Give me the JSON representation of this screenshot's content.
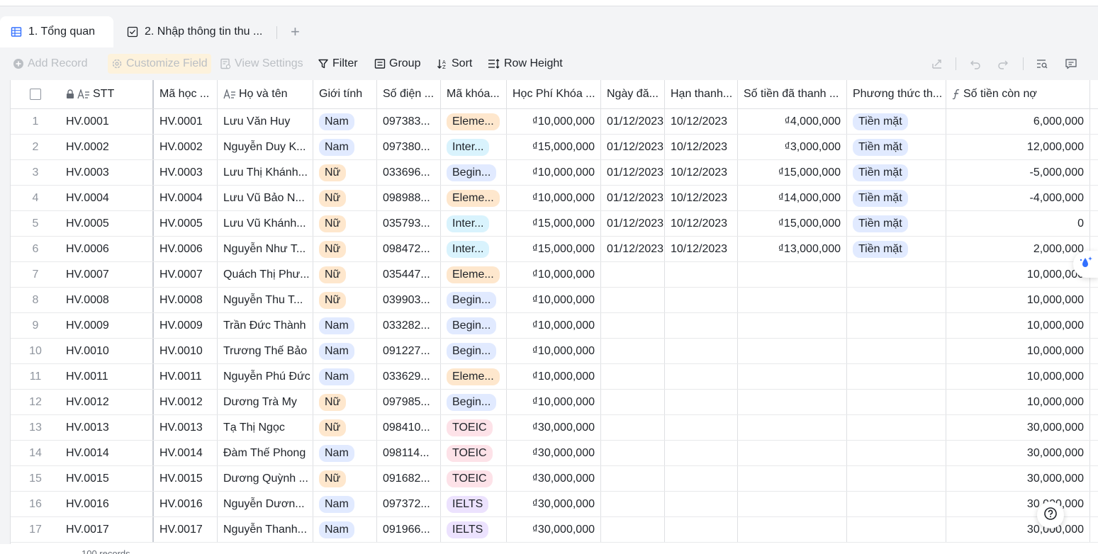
{
  "tabs": [
    {
      "label": "1. Tổng quan",
      "active": true
    },
    {
      "label": "2. Nhập thông tin thu ...",
      "active": false
    }
  ],
  "toolbar": {
    "add_record": "Add Record",
    "customize_field": "Customize Field",
    "view_settings": "View Settings",
    "filter": "Filter",
    "group": "Group",
    "sort": "Sort",
    "row_height": "Row Height"
  },
  "columns": [
    "STT",
    "Mã học ...",
    "Họ và tên",
    "Giới tính",
    "Số điện ...",
    "Mã khóa...",
    "Học Phí Khóa ...",
    "Ngày đă...",
    "Hạn thanh...",
    "Số tiền đã thanh ...",
    "Phương thức th...",
    "Số tiền còn nợ"
  ],
  "rows": [
    {
      "idx": "1",
      "stt": "HV.0001",
      "ma": "HV.0001",
      "name": "Lưu Văn Huy",
      "gender": "Nam",
      "phone": "097383...",
      "course": "Eleme...",
      "course_type": "elem",
      "fee": "₫10,000,000",
      "date": "01/12/2023",
      "due": "10/12/2023",
      "paid": "₫4,000,000",
      "method": "Tiền mặt",
      "debt": "6,000,000"
    },
    {
      "idx": "2",
      "stt": "HV.0002",
      "ma": "HV.0002",
      "name": "Nguyễn Duy K...",
      "gender": "Nam",
      "phone": "097380...",
      "course": "Inter...",
      "course_type": "inter",
      "fee": "₫15,000,000",
      "date": "01/12/2023",
      "due": "10/12/2023",
      "paid": "₫3,000,000",
      "method": "Tiền mặt",
      "debt": "12,000,000"
    },
    {
      "idx": "3",
      "stt": "HV.0003",
      "ma": "HV.0003",
      "name": "Lưu Thị Khánh...",
      "gender": "Nữ",
      "phone": "033696...",
      "course": "Begin...",
      "course_type": "begin",
      "fee": "₫10,000,000",
      "date": "01/12/2023",
      "due": "10/12/2023",
      "paid": "₫15,000,000",
      "method": "Tiền mặt",
      "debt": "-5,000,000"
    },
    {
      "idx": "4",
      "stt": "HV.0004",
      "ma": "HV.0004",
      "name": "Lưu Vũ Bảo N...",
      "gender": "Nữ",
      "phone": "098988...",
      "course": "Eleme...",
      "course_type": "elem",
      "fee": "₫10,000,000",
      "date": "01/12/2023",
      "due": "10/12/2023",
      "paid": "₫14,000,000",
      "method": "Tiền mặt",
      "debt": "-4,000,000"
    },
    {
      "idx": "5",
      "stt": "HV.0005",
      "ma": "HV.0005",
      "name": "Lưu Vũ Khánh...",
      "gender": "Nữ",
      "phone": "035793...",
      "course": "Inter...",
      "course_type": "inter",
      "fee": "₫15,000,000",
      "date": "01/12/2023",
      "due": "10/12/2023",
      "paid": "₫15,000,000",
      "method": "Tiền mặt",
      "debt": "0"
    },
    {
      "idx": "6",
      "stt": "HV.0006",
      "ma": "HV.0006",
      "name": "Nguyễn Như T...",
      "gender": "Nữ",
      "phone": "098472...",
      "course": "Inter...",
      "course_type": "inter",
      "fee": "₫15,000,000",
      "date": "01/12/2023",
      "due": "10/12/2023",
      "paid": "₫13,000,000",
      "method": "Tiền mặt",
      "debt": "2,000,000"
    },
    {
      "idx": "7",
      "stt": "HV.0007",
      "ma": "HV.0007",
      "name": "Quách Thị Phư...",
      "gender": "Nữ",
      "phone": "035447...",
      "course": "Eleme...",
      "course_type": "elem",
      "fee": "₫10,000,000",
      "date": "",
      "due": "",
      "paid": "",
      "method": "",
      "debt": "10,000,000"
    },
    {
      "idx": "8",
      "stt": "HV.0008",
      "ma": "HV.0008",
      "name": "Nguyễn Thu T...",
      "gender": "Nữ",
      "phone": "039903...",
      "course": "Begin...",
      "course_type": "begin",
      "fee": "₫10,000,000",
      "date": "",
      "due": "",
      "paid": "",
      "method": "",
      "debt": "10,000,000"
    },
    {
      "idx": "9",
      "stt": "HV.0009",
      "ma": "HV.0009",
      "name": "Trần Đức Thành",
      "gender": "Nam",
      "phone": "033282...",
      "course": "Begin...",
      "course_type": "begin",
      "fee": "₫10,000,000",
      "date": "",
      "due": "",
      "paid": "",
      "method": "",
      "debt": "10,000,000"
    },
    {
      "idx": "10",
      "stt": "HV.0010",
      "ma": "HV.0010",
      "name": "Trương Thế Bảo",
      "gender": "Nam",
      "phone": "091227...",
      "course": "Begin...",
      "course_type": "begin",
      "fee": "₫10,000,000",
      "date": "",
      "due": "",
      "paid": "",
      "method": "",
      "debt": "10,000,000"
    },
    {
      "idx": "11",
      "stt": "HV.0011",
      "ma": "HV.0011",
      "name": "Nguyễn Phú Đức",
      "gender": "Nam",
      "phone": "033629...",
      "course": "Eleme...",
      "course_type": "elem",
      "fee": "₫10,000,000",
      "date": "",
      "due": "",
      "paid": "",
      "method": "",
      "debt": "10,000,000"
    },
    {
      "idx": "12",
      "stt": "HV.0012",
      "ma": "HV.0012",
      "name": "Dương Trà My",
      "gender": "Nữ",
      "phone": "097985...",
      "course": "Begin...",
      "course_type": "begin",
      "fee": "₫10,000,000",
      "date": "",
      "due": "",
      "paid": "",
      "method": "",
      "debt": "10,000,000"
    },
    {
      "idx": "13",
      "stt": "HV.0013",
      "ma": "HV.0013",
      "name": "Tạ Thị Ngọc",
      "gender": "Nữ",
      "phone": "098410...",
      "course": "TOEIC",
      "course_type": "toeic",
      "fee": "₫30,000,000",
      "date": "",
      "due": "",
      "paid": "",
      "method": "",
      "debt": "30,000,000"
    },
    {
      "idx": "14",
      "stt": "HV.0014",
      "ma": "HV.0014",
      "name": "Đàm Thế Phong",
      "gender": "Nam",
      "phone": "098114...",
      "course": "TOEIC",
      "course_type": "toeic",
      "fee": "₫30,000,000",
      "date": "",
      "due": "",
      "paid": "",
      "method": "",
      "debt": "30,000,000"
    },
    {
      "idx": "15",
      "stt": "HV.0015",
      "ma": "HV.0015",
      "name": "Dương Quỳnh ...",
      "gender": "Nữ",
      "phone": "091682...",
      "course": "TOEIC",
      "course_type": "toeic",
      "fee": "₫30,000,000",
      "date": "",
      "due": "",
      "paid": "",
      "method": "",
      "debt": "30,000,000"
    },
    {
      "idx": "16",
      "stt": "HV.0016",
      "ma": "HV.0016",
      "name": "Nguyễn Dươn...",
      "gender": "Nam",
      "phone": "097372...",
      "course": "IELTS",
      "course_type": "ielts",
      "fee": "₫30,000,000",
      "date": "",
      "due": "",
      "paid": "",
      "method": "",
      "debt": "30,000,000"
    },
    {
      "idx": "17",
      "stt": "HV.0017",
      "ma": "HV.0017",
      "name": "Nguyễn Thanh...",
      "gender": "Nam",
      "phone": "091966...",
      "course": "IELTS",
      "course_type": "ielts",
      "fee": "₫30,000,000",
      "date": "",
      "due": "",
      "paid": "",
      "method": "",
      "debt": "30,000,000"
    }
  ],
  "footer": {
    "records": "100 records"
  },
  "colors": {
    "accent": "#3370ff",
    "tag_nam": "#e1eaff",
    "tag_nu": "#fee7cd"
  }
}
